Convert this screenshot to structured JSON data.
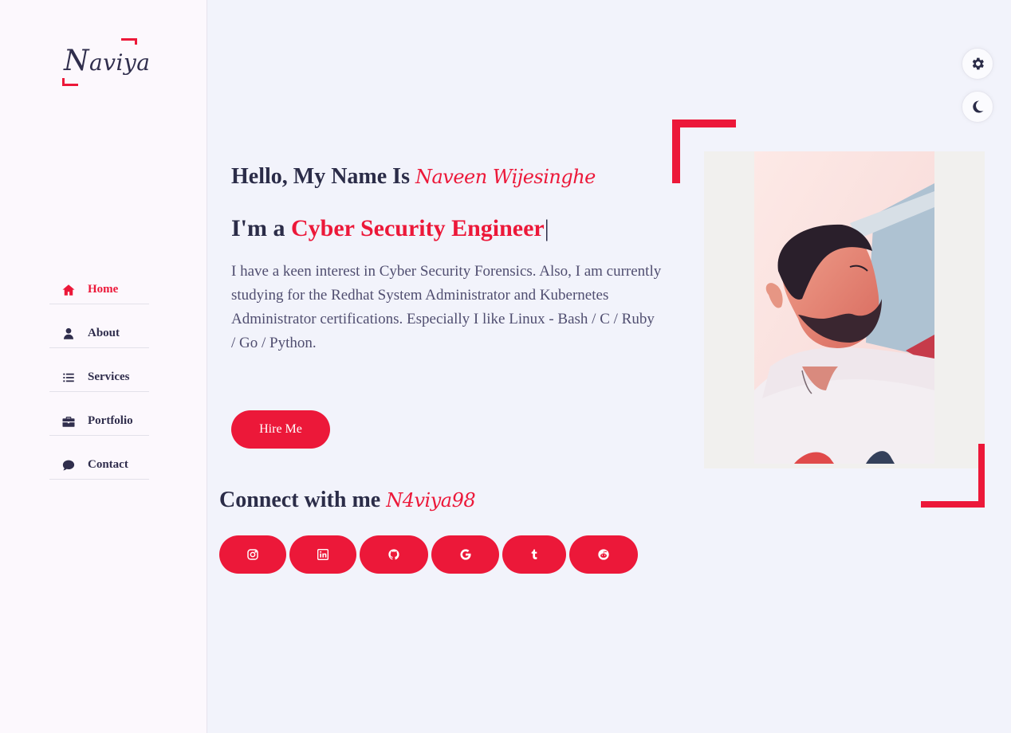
{
  "logo": {
    "text_cap": "N",
    "text_rest": "aviya"
  },
  "nav": {
    "items": [
      {
        "label": "Home",
        "icon": "home-icon",
        "active": true
      },
      {
        "label": "About",
        "icon": "user-icon",
        "active": false
      },
      {
        "label": "Services",
        "icon": "list-icon",
        "active": false
      },
      {
        "label": "Portfolio",
        "icon": "briefcase-icon",
        "active": false
      },
      {
        "label": "Contact",
        "icon": "comment-icon",
        "active": false
      }
    ]
  },
  "hero": {
    "greeting": "Hello, My Name Is ",
    "name": "Naveen Wijesinghe",
    "role_prefix": "I'm a ",
    "role": "Cyber Security Engineer",
    "cursor": "|",
    "description": "I have a keen interest in Cyber Security Forensics. Also, I am currently studying for the Redhat System Administrator and Kubernetes Administrator certifications. Especially I like Linux - Bash / C / Ruby / Go / Python.",
    "hire_label": "Hire Me"
  },
  "connect": {
    "label": "Connect with me ",
    "handle": "N4viya98",
    "socials": [
      {
        "icon": "instagram-icon"
      },
      {
        "icon": "linkedin-icon"
      },
      {
        "icon": "github-icon"
      },
      {
        "icon": "google-icon"
      },
      {
        "icon": "tumblr-icon"
      },
      {
        "icon": "reddit-icon"
      }
    ]
  },
  "floating": {
    "settings_icon": "gear-icon",
    "theme_icon": "moon-icon"
  },
  "colors": {
    "accent": "#ec1839",
    "text": "#2b2c48",
    "background": "#f2f3fb",
    "sidebar": "#fcf8fd"
  }
}
